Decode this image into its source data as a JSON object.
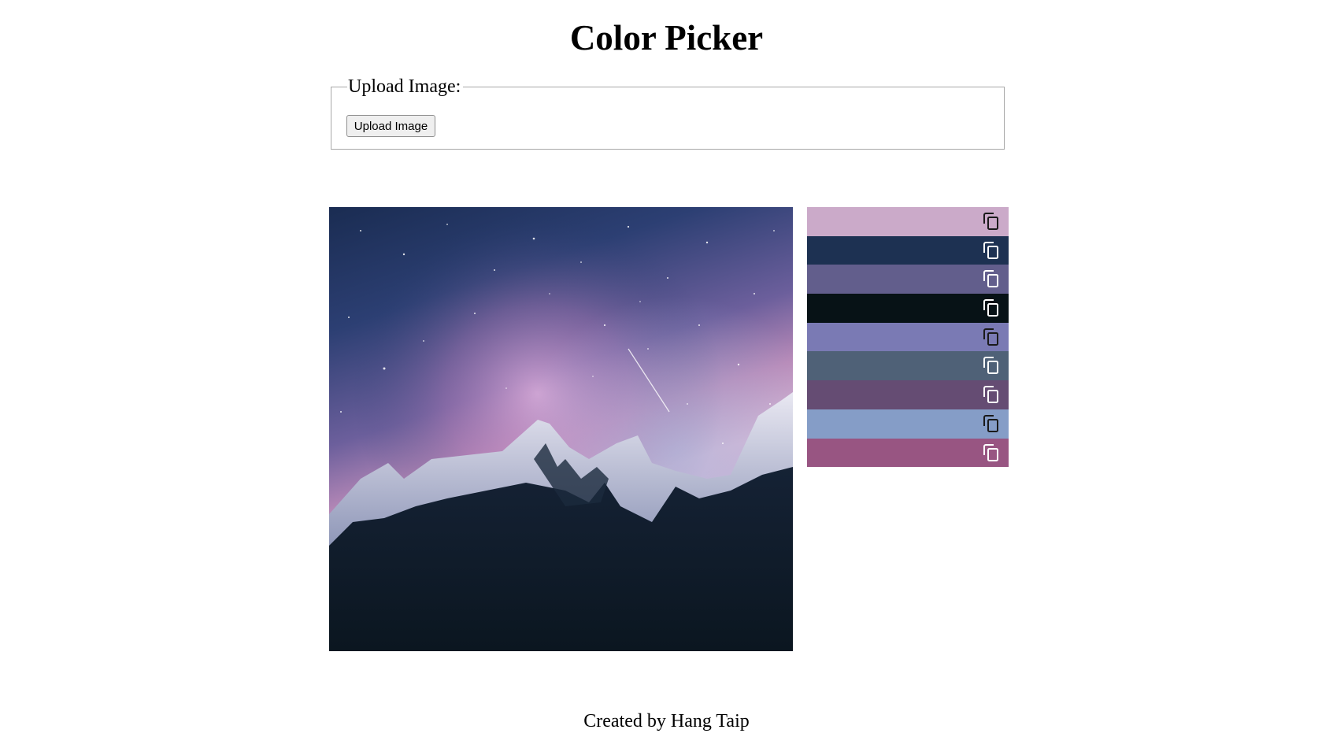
{
  "page": {
    "title": "Color Picker"
  },
  "upload": {
    "legend": "Upload Image:",
    "button_label": "Upload Image"
  },
  "image": {
    "description": "uploaded-photo",
    "palette_hint": [
      "#1b2d4f",
      "#c9a6c7"
    ]
  },
  "palette": {
    "swatches": [
      {
        "color": "#cbaac9",
        "icon": "copy-icon",
        "icon_color": "#1a1a1a"
      },
      {
        "color": "#1d3152",
        "icon": "copy-icon",
        "icon_color": "#ffffff"
      },
      {
        "color": "#625e8c",
        "icon": "copy-icon",
        "icon_color": "#ffffff"
      },
      {
        "color": "#071216",
        "icon": "copy-icon",
        "icon_color": "#ffffff"
      },
      {
        "color": "#7a7ab4",
        "icon": "copy-icon",
        "icon_color": "#1a1a1a"
      },
      {
        "color": "#4f6177",
        "icon": "copy-icon",
        "icon_color": "#ffffff"
      },
      {
        "color": "#654c73",
        "icon": "copy-icon",
        "icon_color": "#ffffff"
      },
      {
        "color": "#859dc7",
        "icon": "copy-icon",
        "icon_color": "#1a1a1a"
      },
      {
        "color": "#985582",
        "icon": "copy-icon",
        "icon_color": "#ffffff"
      }
    ]
  },
  "footer": {
    "text": "Created by Hang Taip"
  }
}
